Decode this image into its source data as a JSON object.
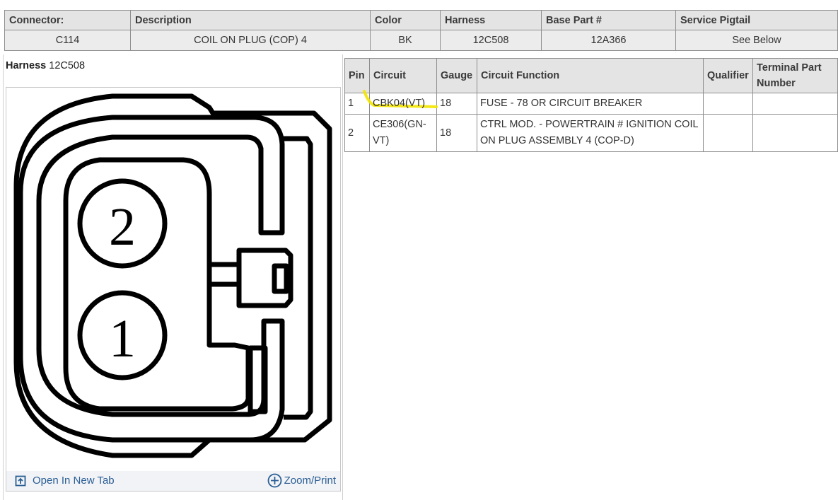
{
  "connector_summary": {
    "headers": [
      "Connector:",
      "Description",
      "Color",
      "Harness",
      "Base Part #",
      "Service Pigtail"
    ],
    "values": [
      "C114",
      "COIL ON PLUG (COP) 4",
      "BK",
      "12C508",
      "12A366",
      "See Below"
    ]
  },
  "harness_panel": {
    "label": "Harness",
    "value": "12C508",
    "pins": [
      "2",
      "1"
    ],
    "open_tab_label": "Open In New Tab",
    "zoom_print_label": "Zoom/Print"
  },
  "pin_table": {
    "headers": [
      "Pin",
      "Circuit",
      "Gauge",
      "Circuit Function",
      "Qualifier",
      "Terminal Part Number"
    ],
    "rows": [
      {
        "pin": "1",
        "circuit": "CBK04(VT)",
        "gauge": "18",
        "function": "FUSE - 78 OR CIRCUIT BREAKER",
        "qualifier": "",
        "terminal": ""
      },
      {
        "pin": "2",
        "circuit": "CE306(GN-VT)",
        "gauge": "18",
        "function": "CTRL MOD. - POWERTRAIN # IGNITION COIL ON PLUG ASSEMBLY 4 (COP-D)",
        "qualifier": "",
        "terminal": ""
      }
    ]
  },
  "colors": {
    "header_bg": "#e4e4e4",
    "link": "#2a5e95",
    "highlight": "#f3e600",
    "outline": "#000000"
  }
}
